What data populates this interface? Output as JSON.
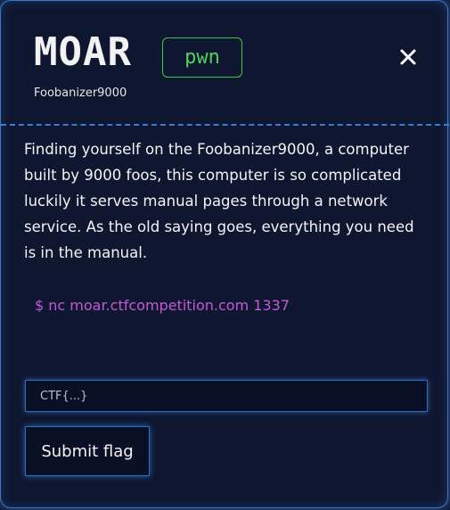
{
  "challenge": {
    "title": "MOAR",
    "author": "Foobanizer9000",
    "category_badge": "pwn",
    "description": "Finding yourself on the Foobanizer9000, a computer built by 9000 foos, this computer is so complicated luckily it serves manual pages through a network service. As the old saying goes, everything you need is in the manual.",
    "command": "$ nc moar.ctfcompetition.com 1337"
  },
  "flag_form": {
    "placeholder": "CTF{...}",
    "value": "",
    "submit_label": "Submit flag"
  },
  "icons": {
    "close": "close-icon"
  },
  "colors": {
    "background": "#131b36",
    "dialog_border": "#3a78c8",
    "badge_green": "#4fd35c",
    "command_purple": "#c35ad6",
    "divider": "#3a7bd5"
  }
}
